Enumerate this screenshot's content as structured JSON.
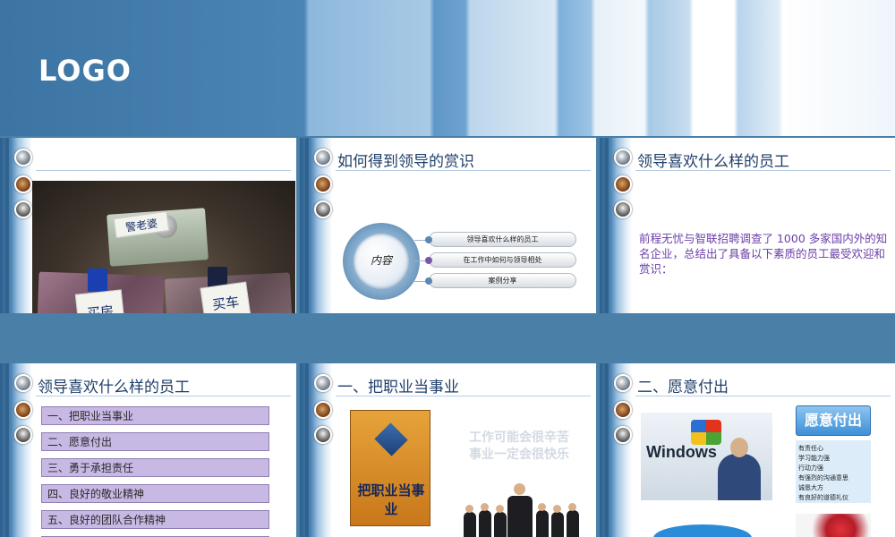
{
  "header": {
    "logo_text": "LOGO"
  },
  "slide1": {
    "title": "",
    "notes": [
      "警老婆",
      "买房",
      "买车"
    ]
  },
  "slide2": {
    "title": "如何得到领导的赏识",
    "center_label": "内容",
    "items": [
      "领导喜欢什么样的员工",
      "在工作中如何与领导相处",
      "案例分享"
    ]
  },
  "slide3": {
    "title": "领导喜欢什么样的员工",
    "body": "前程无忧与智联招聘调查了 1000 多家国内外的知名企业，总结出了具备以下素质的员工最受欢迎和赏识："
  },
  "slide4": {
    "title": "领导喜欢什么样的员工",
    "items": [
      "一、把职业当事业",
      "二、愿意付出",
      "三、勇于承担责任",
      "四、良好的敬业精神",
      "五、良好的团队合作精神",
      ""
    ]
  },
  "slide5": {
    "title": "一、把职业当事业",
    "book_title": "把职业当事业",
    "slogan_lines": [
      "工作可能会很辛苦",
      "事业一定会很快乐"
    ]
  },
  "slide6": {
    "title": "二、愿意付出",
    "windows_text": "Windows",
    "button_label": "愿意付出",
    "traits": [
      "有责任心",
      "学习能力强",
      "行动力强",
      "有强烈的沟通意思",
      "诚恳大方",
      "有良好的道德礼仪"
    ]
  }
}
